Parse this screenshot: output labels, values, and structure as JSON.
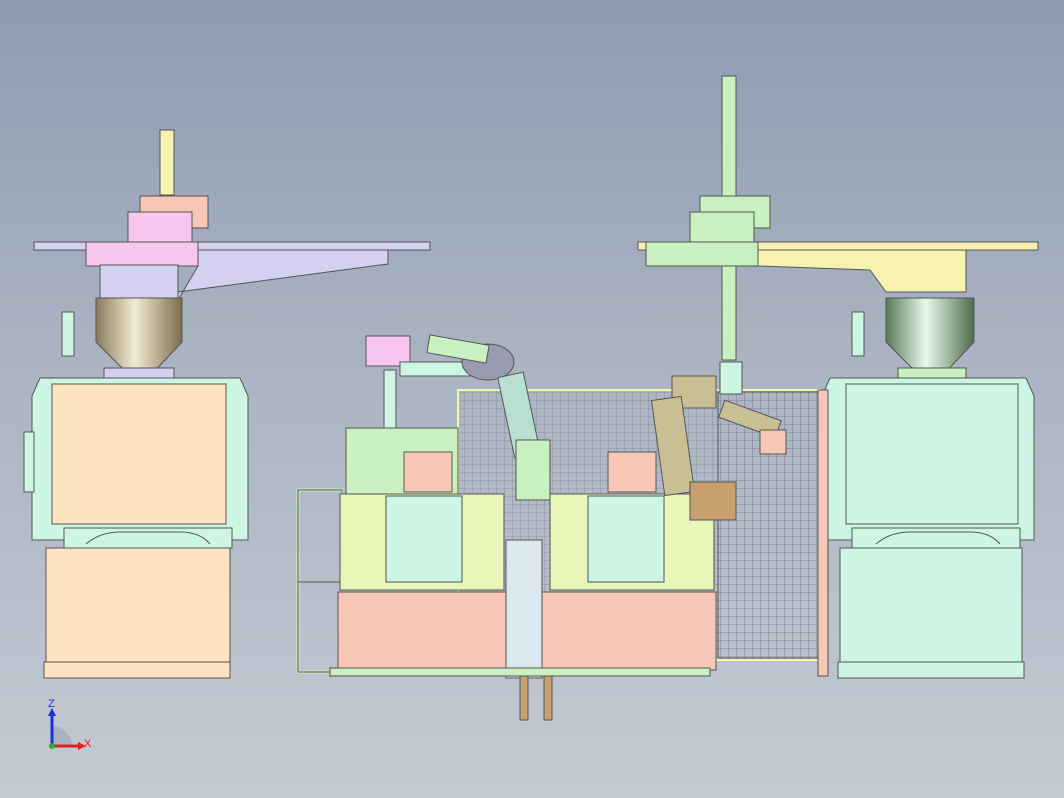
{
  "triad": {
    "x_label": "X",
    "z_label": "Z",
    "x_color": "#e02020",
    "z_color": "#2030e0",
    "y_color": "#20b020"
  },
  "colors": {
    "background_top": "#8e9bb0",
    "background_bottom": "#c4cad3",
    "peach": "#fde3c0",
    "mint": "#ccf5e4",
    "lime": "#e8f5b8",
    "salmon": "#f6c7b6",
    "lavender": "#d4d0f0",
    "pink": "#f8c6ee",
    "yellow": "#f8f2b0",
    "green": "#c8f0c0",
    "olive": "#c8c094"
  }
}
